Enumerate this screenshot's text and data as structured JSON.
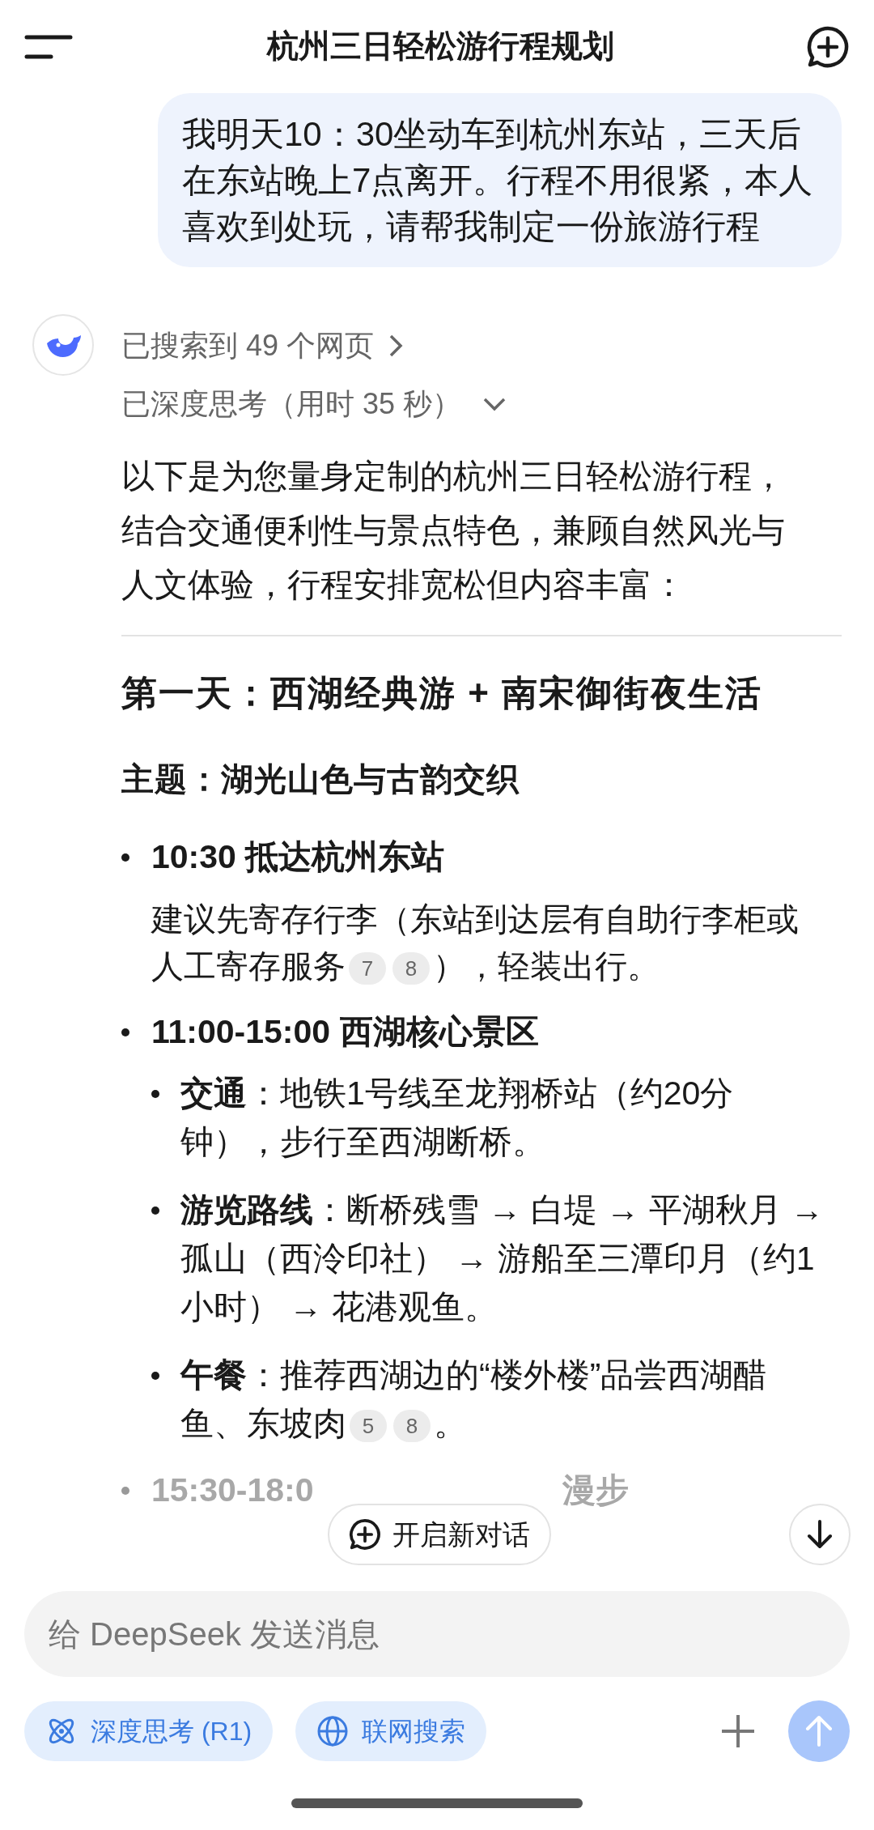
{
  "header": {
    "title": "杭州三日轻松游行程规划"
  },
  "user_message": "我明天10：30坐动车到杭州东站，三天后在东站晚上7点离开。行程不用很紧，本人喜欢到处玩，请帮我制定一份旅游行程",
  "reply": {
    "search_status": "已搜索到 49 个网页",
    "thinking_status": "已深度思考（用时 35 秒）",
    "intro": "以下是为您量身定制的杭州三日轻松游行程，结合交通便利性与景点特色，兼顾自然风光与人文体验，行程安排宽松但内容丰富：",
    "day_heading": "第一天：西湖经典游 + 南宋御街夜生活",
    "theme": "主题：湖光山色与古韵交织",
    "items": [
      {
        "title": "10:30 抵达杭州东站",
        "parts": [
          {
            "kind": "text",
            "text": "建议先寄存行李（东站到达层有自助行李柜或人工寄存服务"
          },
          {
            "kind": "cite",
            "text": "7"
          },
          {
            "kind": "cite",
            "text": "8"
          },
          {
            "kind": "text",
            "text": "），轻装出行。"
          }
        ]
      },
      {
        "title": "11:00-15:00 西湖核心景区",
        "children": [
          {
            "parts": [
              {
                "kind": "text",
                "text": "**交通**：地铁1号线至龙翔桥站（约20分钟），步行至西湖断桥。"
              }
            ]
          },
          {
            "parts": [
              {
                "kind": "text",
                "text": "**游览路线**：断桥残雪 → 白堤 → 平湖秋月 → 孤山（西泠印社） → 游船至三潭印月（约1小时） → 花港观鱼。"
              }
            ]
          },
          {
            "parts": [
              {
                "kind": "text",
                "text": "**午餐**：推荐西湖边的“楼外楼”品尝西湖醋鱼、东坡肉"
              },
              {
                "kind": "cite",
                "text": "5"
              },
              {
                "kind": "cite",
                "text": "8"
              },
              {
                "kind": "text",
                "text": "。"
              }
            ]
          }
        ]
      },
      {
        "title_parts": [
          "15:30-18:0",
          "漫步"
        ]
      }
    ]
  },
  "new_chat_button": {
    "label": "开启新对话"
  },
  "input": {
    "placeholder": "给 DeepSeek 发送消息"
  },
  "toggles": [
    {
      "kind": "atom",
      "label": "深度思考 (R1)",
      "selected": true
    },
    {
      "kind": "globe",
      "label": "联网搜索",
      "selected": true
    }
  ],
  "send_button": {
    "disabled": true
  }
}
